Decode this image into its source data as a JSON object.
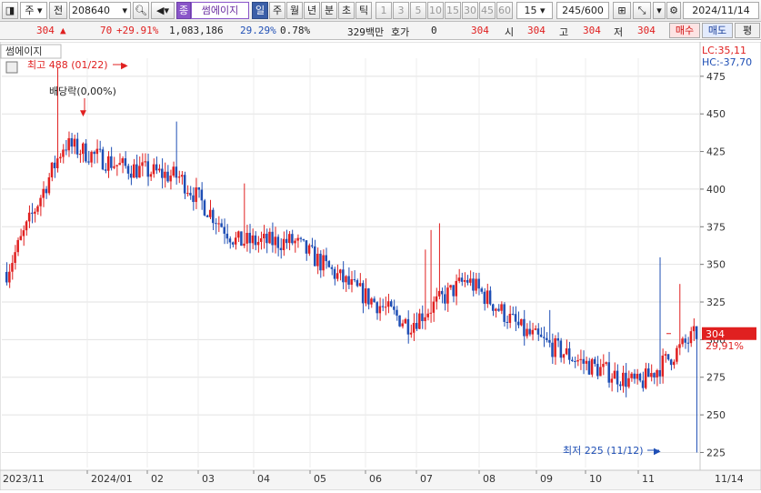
{
  "toolbar": {
    "market_type": "주",
    "chart_kind": "전",
    "stock_code": "208640",
    "stock_badge": "종",
    "stock_name": "썸에이지",
    "periods": [
      "일",
      "주",
      "월",
      "년",
      "분",
      "초",
      "틱"
    ],
    "active_period": "일",
    "intervals": [
      "1",
      "3",
      "5",
      "10",
      "15",
      "30",
      "45",
      "60"
    ],
    "interval_value": "15",
    "count_display": "245/600",
    "date_value": "2024/11/14"
  },
  "quote": {
    "price": "304",
    "change": "70",
    "change_rate": "+29.91%",
    "volume": "1,083,186",
    "volume_rate": "29.29%",
    "turnover": "0.78%",
    "amount": "329백만",
    "hoga_label": "호가",
    "hoga_value": "0",
    "hoga_price": "304",
    "open_label": "시",
    "open_value": "304",
    "high_label": "고",
    "high_value": "304",
    "low_label": "저",
    "low_value": "304",
    "buy_label": "매수",
    "sell_label": "매도",
    "avg_label": "평"
  },
  "colors": {
    "up": "#e02020",
    "down": "#1f4fb5",
    "grid": "#e2e2e2",
    "axis_bg": "#ffffff",
    "price_tag": "#e02020"
  },
  "chart_data": {
    "type": "candlestick",
    "title": "썸에이지",
    "y_axis": {
      "ylim": [
        215,
        487
      ],
      "ticks": [
        225,
        250,
        275,
        300,
        325,
        350,
        375,
        400,
        425,
        450,
        475
      ]
    },
    "x_axis": {
      "labels": [
        "2023/11",
        "2024/01",
        "02",
        "03",
        "04",
        "05",
        "06",
        "07",
        "08",
        "09",
        "10",
        "11"
      ],
      "end_label": "11/14"
    },
    "indicators": {
      "lc": "LC:35,11",
      "hc": "HC:-37,70"
    },
    "current_price": {
      "value": "304",
      "change_rate": "29,91%"
    },
    "annotations": {
      "high": "최고 488 (01/22)",
      "low": "최저 225 (11/12)",
      "dividend": "배당락(0,00%)"
    },
    "monthly_path": [
      {
        "month": "2023/11",
        "price": 345
      },
      {
        "month": "2023/12",
        "price": 430
      },
      {
        "month": "2024/01",
        "price": 415
      },
      {
        "month": "02",
        "price": 408
      },
      {
        "month": "03",
        "price": 365
      },
      {
        "month": "04",
        "price": 365
      },
      {
        "month": "05",
        "price": 335
      },
      {
        "month": "06",
        "price": 310
      },
      {
        "month": "07",
        "price": 340
      },
      {
        "month": "08",
        "price": 305
      },
      {
        "month": "09",
        "price": 285
      },
      {
        "month": "10",
        "price": 270
      },
      {
        "month": "11",
        "price": 304
      }
    ]
  }
}
